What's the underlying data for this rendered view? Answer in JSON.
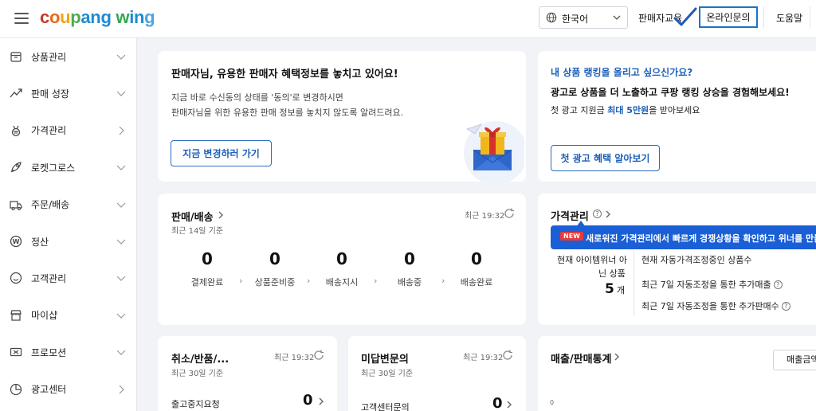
{
  "header": {
    "logo_parts": [
      "c",
      "o",
      "u",
      "p",
      "a",
      "n",
      "g",
      " ",
      "w",
      "i",
      "n",
      "g"
    ],
    "logo_colors": [
      "#c33a2c",
      "#e66a1f",
      "#f3a417",
      "#4bad4f",
      "#1e8ad4",
      "#1e8ad4",
      "#1e8ad4",
      "#fff",
      "#34a853",
      "#1e8ad4",
      "#1e8ad4",
      "#4aa5e0"
    ],
    "language": "한국어",
    "seller_material": "판매자교육",
    "online_inquiry": "온라인문의",
    "help": "도움말"
  },
  "sidebar": {
    "items": [
      {
        "label": "상품관리",
        "icon": "box-icon",
        "arrow": "down"
      },
      {
        "label": "판매 성장",
        "icon": "trending-up-icon",
        "arrow": "down"
      },
      {
        "label": "가격관리",
        "icon": "medal-icon",
        "arrow": "right"
      },
      {
        "label": "로켓그로스",
        "icon": "rocket-icon",
        "arrow": "down"
      },
      {
        "label": "주문/배송",
        "icon": "truck-icon",
        "arrow": "down"
      },
      {
        "label": "정산",
        "icon": "won-coin-icon",
        "arrow": "down"
      },
      {
        "label": "고객관리",
        "icon": "smile-icon",
        "arrow": "down"
      },
      {
        "label": "마이샵",
        "icon": "shop-icon",
        "arrow": "down"
      },
      {
        "label": "프로모션",
        "icon": "ticket-icon",
        "arrow": "down"
      },
      {
        "label": "광고센터",
        "icon": "chart-pie-icon",
        "arrow": "right"
      }
    ]
  },
  "notice_card": {
    "title": "판매자님, 유용한 판매자 혜택정보를 놓치고 있어요!",
    "line1": "지금 바로 수신동의 상태를 '동의'로 변경하시면",
    "line2": "판매자님을 위한 유용한 판매 정보를 놓치지 않도록 알려드려요.",
    "button": "지금 변경하러 가기"
  },
  "ad_card": {
    "question": "내 상품 랭킹을 올리고 싶으신가요?",
    "headline": "광고로 상품을 더 노출하고 쿠팡 랭킹 상승을 경험해보세요!",
    "desc_prefix": "첫 광고 지원금 ",
    "desc_highlight": "최대 5만원",
    "desc_suffix": "을 받아보세요",
    "button": "첫 광고 혜택 알아보기"
  },
  "sales_card": {
    "title": "판매/배송",
    "subtitle": "최근 14일 기준",
    "recent": "최근 19:32",
    "stats": [
      {
        "value": "0",
        "label": "결제완료"
      },
      {
        "value": "0",
        "label": "상품준비중"
      },
      {
        "value": "0",
        "label": "배송지시"
      },
      {
        "value": "0",
        "label": "배송중"
      },
      {
        "value": "0",
        "label": "배송완료"
      }
    ]
  },
  "price_card": {
    "title": "가격관리",
    "banner_badge": "NEW",
    "banner_text": "새로워진 가격관리에서 빠르게 경쟁상황을 확인하고 위너를 만들",
    "winner_label_1": "현재 아이템위너 아",
    "winner_label_2": "닌 상품",
    "winner_count": "5",
    "winner_unit": "개",
    "auto_adjust": "현재 자동가격조정중인 상품수",
    "extra_sales": "최근 7일 자동조정을 통한 추가매출",
    "extra_qty": "최근 7일 자동조정을 통한 추가판매수"
  },
  "cancel_card": {
    "title": "취소/반품/...",
    "subtitle": "최근 30일 기준",
    "recent": "최근 19:32",
    "row_label": "출고중지요청",
    "row_value": "0"
  },
  "inquiry_card": {
    "title": "미답변문의",
    "subtitle": "최근 30일 기준",
    "recent": "최근 19:32",
    "row_label": "고객센터문의",
    "row_value": "0"
  },
  "sales_stats_card": {
    "title": "매출/판매통계",
    "button": "매출금액",
    "axis_zero": "0"
  }
}
